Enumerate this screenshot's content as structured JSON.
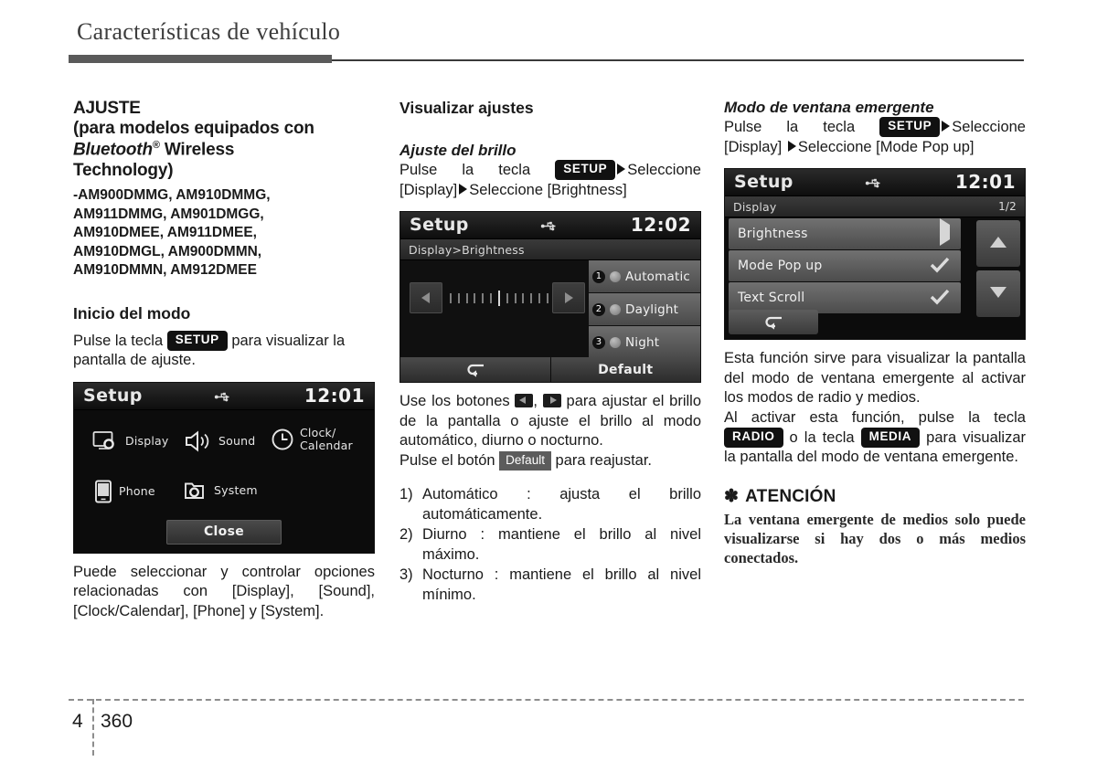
{
  "header": {
    "title": "Características de vehículo"
  },
  "left_column": {
    "section_title_line1": "AJUSTE",
    "section_title_line2": "(para modelos equipados con",
    "section_title_bt": "Bluetooth",
    "section_title_sup": "®",
    "section_title_line3_rest": " Wireless",
    "section_title_line4": "Technology)",
    "models": "-AM900DMMG, AM910DMMG,\n AM911DMMG, AM901DMGG,\n AM910DMEE, AM911DMEE,\n AM910DMGL, AM900DMMN,\n AM910DMMN, AM912DMEE",
    "mode_start_title": "Inicio del modo",
    "mode_start_text_a": "Pulse la tecla ",
    "mode_start_key": "SETUP",
    "mode_start_text_b": " para visualizar la pantalla de ajuste.",
    "caption": "Puede seleccionar y controlar opciones relacionadas con [Display], [Sound], [Clock/Calendar], [Phone] y [System].",
    "device": {
      "title": "Setup",
      "clock": "12:01",
      "usb_icon": "usb-icon",
      "items": [
        {
          "label": "Display",
          "icon": "display-gear-icon"
        },
        {
          "label": "Sound",
          "icon": "speaker-icon"
        },
        {
          "label_line1": "Clock/",
          "label_line2": "Calendar",
          "icon": "clock-icon"
        },
        {
          "label": "Phone",
          "icon": "phone-icon"
        },
        {
          "label": "System",
          "icon": "folder-gear-icon"
        }
      ],
      "close_label": "Close"
    }
  },
  "mid_column": {
    "section_title": "Visualizar ajustes",
    "sub_title": "Ajuste del brillo",
    "path_text_a": "Pulse la tecla ",
    "path_key": "SETUP",
    "path_text_b": "Seleccione [Display]",
    "path_text_c": "Seleccione [Brightness]",
    "device": {
      "title": "Setup",
      "clock": "12:02",
      "breadcrumb": "Display>Brightness",
      "options": [
        {
          "num": "1",
          "label": "Automatic"
        },
        {
          "num": "2",
          "label": "Daylight"
        },
        {
          "num": "3",
          "label": "Night"
        }
      ],
      "back_icon": "back-arrow-icon",
      "default_label": "Default",
      "slider_ticks": 13,
      "slider_active_index": 6
    },
    "caption_a": "Use los botones ",
    "caption_b": ", ",
    "caption_c": " para ajustar el brillo de la pantalla o ajuste el brillo al modo automático, diurno o nocturno.",
    "caption_d": "Pulse el botón ",
    "caption_default_key": "Default",
    "caption_e": " para reajustar.",
    "list": [
      {
        "n": "1)",
        "text": "Automático : ajusta el brillo automáticamente."
      },
      {
        "n": "2)",
        "text": "Diurno : mantiene el brillo al nivel máximo."
      },
      {
        "n": "3)",
        "text": "Nocturno : mantiene el brillo al nivel mínimo."
      }
    ]
  },
  "right_column": {
    "sub_title": "Modo de ventana emergente",
    "path_text_a": "Pulse la tecla ",
    "path_key": "SETUP",
    "path_text_b": "Seleccione [Display] ",
    "path_text_c": "Seleccione [Mode Pop up]",
    "device": {
      "title": "Setup",
      "clock": "12:01",
      "breadcrumb": "Display",
      "page_indicator": "1/2",
      "rows": [
        {
          "label": "Brightness",
          "mark": "chevron-right-icon"
        },
        {
          "label": "Mode Pop up",
          "mark": "check-icon"
        },
        {
          "label": "Text Scroll",
          "mark": "check-icon"
        }
      ],
      "back_icon": "back-arrow-icon",
      "scroll_up_icon": "scroll-up-icon",
      "scroll_down_icon": "scroll-down-icon"
    },
    "para1": "Esta función sirve para visualizar la pantalla del modo de ventana emergente al activar los modos de radio y medios.",
    "para2_a": "Al activar esta función, pulse la tecla ",
    "para2_key1": "RADIO",
    "para2_b": " o la tecla ",
    "para2_key2": "MEDIA",
    "para2_c": " para visualizar la pantalla del modo de ventana emergente.",
    "warning_symbol": "✽",
    "warning_title": "ATENCIÓN",
    "warning_body": "La ventana emergente de medios solo puede visualizarse si hay dos o más medios conectados."
  },
  "footer": {
    "chapter": "4",
    "page": "360"
  }
}
